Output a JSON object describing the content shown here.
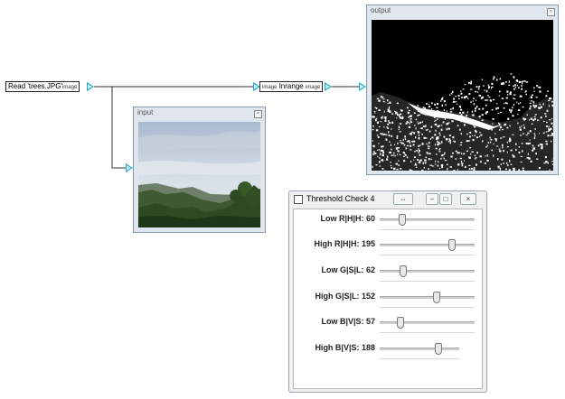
{
  "graph": {
    "read_node": {
      "label": "Read 'trees.JPG'",
      "out_port": "image"
    },
    "inrange_node": {
      "in_port": "image",
      "label": "Inrange",
      "out_port": "image"
    }
  },
  "input_viewer": {
    "title": "input",
    "close": "×"
  },
  "output_viewer": {
    "title": "output",
    "close": "×"
  },
  "dialog": {
    "title": "Threshold Check 4",
    "restore_symbol": "⇔",
    "minimize_symbol": "–",
    "maximize_symbol": "□",
    "close_symbol": "×",
    "sliders": [
      {
        "label": "Low  R|H|H: 60",
        "value": 60,
        "max": 255
      },
      {
        "label": "High R|H|H: 195",
        "value": 195,
        "max": 255
      },
      {
        "label": "Low  G|S|L: 62",
        "value": 62,
        "max": 255
      },
      {
        "label": "High G|S|L: 152",
        "value": 152,
        "max": 255
      },
      {
        "label": "Low  B|V|S: 57",
        "value": 57,
        "max": 255
      },
      {
        "label": "High B|V|S: 188",
        "value": 188,
        "max": 255
      }
    ]
  },
  "colors": {
    "port": "#2aa8c8",
    "accent": "#2aa8c8"
  }
}
